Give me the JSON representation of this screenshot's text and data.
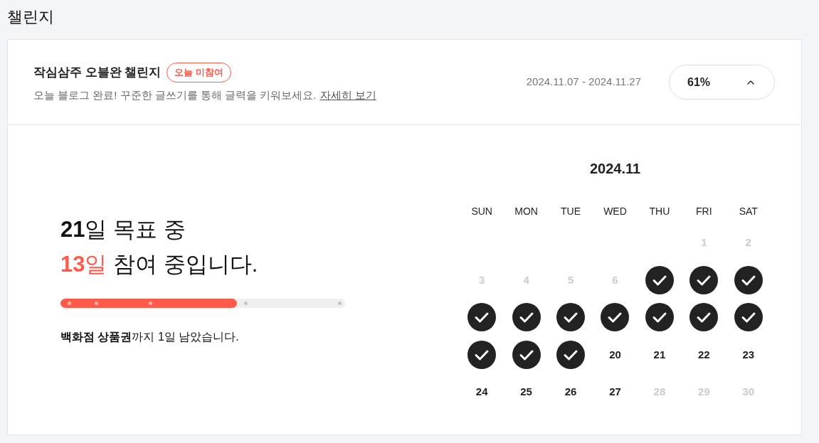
{
  "page_title": "챌린지",
  "challenge": {
    "title": "작심삼주 오블완 챌린지",
    "status_badge": "오늘 미참여",
    "description": "오늘 블로그 완료! 꾸준한 글쓰기를 통해 글력을 키워보세요.",
    "details_link": "자세히 보기",
    "period": "2024.11.07 - 2024.11.27",
    "progress_toggle": {
      "label": "61%",
      "expanded": true
    }
  },
  "summary": {
    "goal_line": "**21**일 목표 중",
    "participation_highlight": "**13**일",
    "participation_rest": " 참여 중입니다.",
    "progress": {
      "level": 0.62
    },
    "reward_line": "**백화점 상품권**까지 1일 남았습니다."
  },
  "calendar": {
    "month": "2024.11",
    "weekdays": [
      "SUN",
      "MON",
      "TUE",
      "WED",
      "THU",
      "FRI",
      "SAT"
    ],
    "weeks": [
      [
        {
          "kind": "blank"
        },
        {
          "kind": "blank"
        },
        {
          "kind": "blank"
        },
        {
          "kind": "blank"
        },
        {
          "kind": "blank"
        },
        {
          "kind": "outside",
          "label": "1"
        },
        {
          "kind": "outside",
          "label": "2"
        }
      ],
      [
        {
          "kind": "outside",
          "label": "3"
        },
        {
          "kind": "outside",
          "label": "4"
        },
        {
          "kind": "outside",
          "label": "5"
        },
        {
          "kind": "outside",
          "label": "6"
        },
        {
          "kind": "done"
        },
        {
          "kind": "done"
        },
        {
          "kind": "done"
        }
      ],
      [
        {
          "kind": "done"
        },
        {
          "kind": "done"
        },
        {
          "kind": "done"
        },
        {
          "kind": "done"
        },
        {
          "kind": "done"
        },
        {
          "kind": "done"
        },
        {
          "kind": "done"
        }
      ],
      [
        {
          "kind": "done"
        },
        {
          "kind": "done"
        },
        {
          "kind": "done"
        },
        {
          "kind": "open",
          "label": "20"
        },
        {
          "kind": "open",
          "label": "21"
        },
        {
          "kind": "open",
          "label": "22"
        },
        {
          "kind": "open",
          "label": "23"
        }
      ],
      [
        {
          "kind": "open",
          "label": "24"
        },
        {
          "kind": "open",
          "label": "25"
        },
        {
          "kind": "open",
          "label": "26"
        },
        {
          "kind": "open",
          "label": "27"
        },
        {
          "kind": "outside",
          "label": "28"
        },
        {
          "kind": "outside",
          "label": "29"
        },
        {
          "kind": "outside",
          "label": "30"
        }
      ]
    ]
  }
}
